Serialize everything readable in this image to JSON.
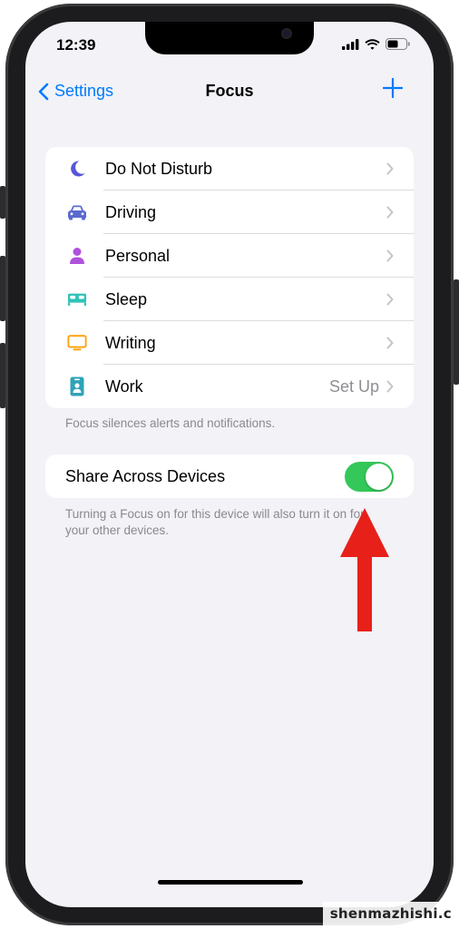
{
  "status_bar": {
    "time": "12:39"
  },
  "nav": {
    "back_label": "Settings",
    "title": "Focus",
    "add_label": "+"
  },
  "focus_modes": [
    {
      "label": "Do Not Disturb",
      "icon": "moon-icon",
      "color": "#5856d6",
      "detail": ""
    },
    {
      "label": "Driving",
      "icon": "car-icon",
      "color": "#5a6acf",
      "detail": ""
    },
    {
      "label": "Personal",
      "icon": "person-icon",
      "color": "#af52de",
      "detail": ""
    },
    {
      "label": "Sleep",
      "icon": "bed-icon",
      "color": "#30c3b8",
      "detail": ""
    },
    {
      "label": "Writing",
      "icon": "monitor-icon",
      "color": "#ff9f0a",
      "detail": ""
    },
    {
      "label": "Work",
      "icon": "badge-icon",
      "color": "#2fa3b8",
      "detail": "Set Up"
    }
  ],
  "focus_footnote": "Focus silences alerts and notifications.",
  "share": {
    "label": "Share Across Devices",
    "toggle_on": true,
    "toggle_color": "#34c759",
    "footnote": "Turning a Focus on for this device will also turn it on for your other devices."
  },
  "annotation": {
    "arrow_color": "#e8201a"
  },
  "watermark": "shenmazhishi.c"
}
